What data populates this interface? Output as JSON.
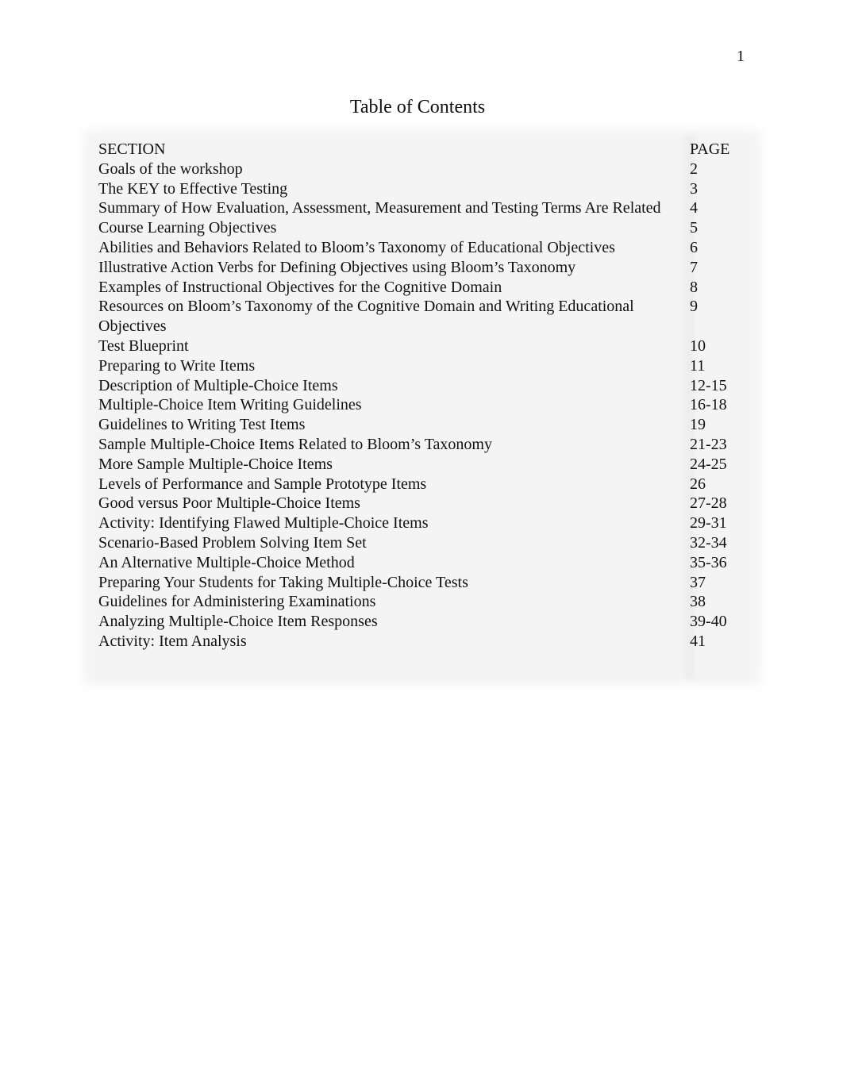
{
  "page_number": "1",
  "title": "Table of Contents",
  "toc": {
    "header": {
      "section": "SECTION",
      "page": "PAGE"
    },
    "rows": [
      {
        "section": "Goals of the workshop",
        "page": "2"
      },
      {
        "section": "The KEY to Effective Testing",
        "page": "3"
      },
      {
        "section": "Summary of How Evaluation, Assessment, Measurement and Testing Terms Are Related",
        "page": "4"
      },
      {
        "section": "Course Learning Objectives",
        "page": "5"
      },
      {
        "section": "Abilities and Behaviors Related to Bloom’s Taxonomy of Educational Objectives",
        "page": "6"
      },
      {
        "section": "Illustrative Action Verbs for Defining Objectives using Bloom’s Taxonomy",
        "page": "7"
      },
      {
        "section": "Examples of Instructional Objectives for the Cognitive Domain",
        "page": "8"
      },
      {
        "section": "Resources on Bloom’s Taxonomy of the Cognitive Domain and Writing Educational Objectives",
        "page": "9"
      },
      {
        "section": "Test Blueprint",
        "page": "10"
      },
      {
        "section": "Preparing to Write Items",
        "page": "11"
      },
      {
        "section": "Description of Multiple-Choice Items",
        "page": "12-15"
      },
      {
        "section": "Multiple-Choice Item Writing Guidelines",
        "page": "16-18"
      },
      {
        "section": "Guidelines to Writing Test Items",
        "page": "19"
      },
      {
        "section": "Sample Multiple-Choice Items Related to Bloom’s Taxonomy",
        "page": "21-23"
      },
      {
        "section": "More Sample Multiple-Choice Items",
        "page": "24-25"
      },
      {
        "section": "Levels of Performance and Sample Prototype Items",
        "page": "26"
      },
      {
        "section": "Good versus Poor Multiple-Choice Items",
        "page": "27-28"
      },
      {
        "section": "Activity:  Identifying Flawed Multiple-Choice Items",
        "page": "29-31"
      },
      {
        "section": "Scenario-Based Problem Solving Item Set",
        "page": "32-34"
      },
      {
        "section": "An Alternative Multiple-Choice Method",
        "page": "35-36"
      },
      {
        "section": "Preparing Your Students for Taking Multiple-Choice Tests",
        "page": "37"
      },
      {
        "section": "Guidelines for Administering Examinations",
        "page": "38"
      },
      {
        "section": "Analyzing Multiple-Choice Item Responses",
        "page": "39-40"
      },
      {
        "section": "Activity:  Item Analysis",
        "page": "41"
      }
    ]
  }
}
